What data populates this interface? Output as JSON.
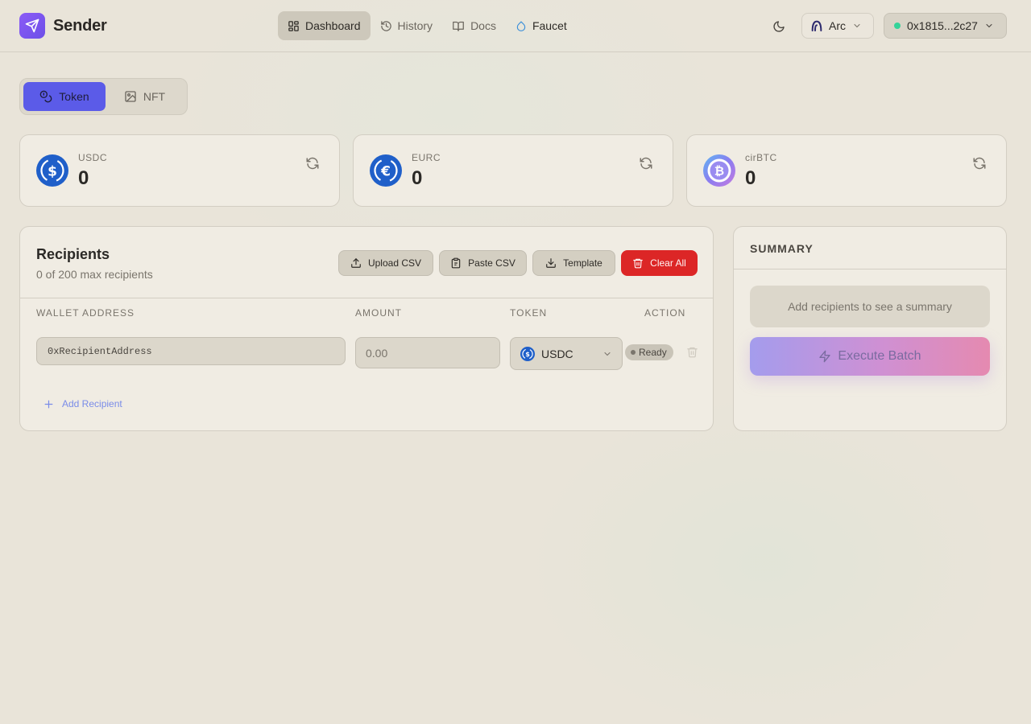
{
  "app": {
    "name": "Sender"
  },
  "nav": {
    "dashboard": "Dashboard",
    "history": "History",
    "docs": "Docs",
    "faucet": "Faucet"
  },
  "header": {
    "chain_label": "Arc",
    "wallet_address": "0x1815...2c27",
    "wallet_status_color": "#34d399"
  },
  "mode": {
    "token": "Token",
    "nft": "NFT",
    "active": "Token"
  },
  "balances": [
    {
      "symbol": "USDC",
      "amount": "0",
      "icon": "usdc-icon",
      "color": "#1f5fc9"
    },
    {
      "symbol": "EURC",
      "amount": "0",
      "icon": "eurc-icon",
      "color": "#1f5fc9"
    },
    {
      "symbol": "cirBTC",
      "amount": "0",
      "icon": "cirbtc-icon",
      "color": "#8b7cf0"
    }
  ],
  "recipients": {
    "title": "Recipients",
    "subtitle": "0 of 200 max recipients",
    "buttons": {
      "upload": "Upload CSV",
      "paste": "Paste CSV",
      "template": "Template",
      "clear": "Clear All"
    },
    "columns": {
      "address": "WALLET ADDRESS",
      "amount": "AMOUNT",
      "token": "TOKEN",
      "action": "ACTION"
    },
    "row": {
      "address_placeholder": "0xRecipientAddress",
      "amount_placeholder": "0.00",
      "token": "USDC",
      "status": "Ready"
    },
    "add_label": "Add Recipient"
  },
  "summary": {
    "title": "SUMMARY",
    "empty_text": "Add recipients to see a summary",
    "execute_label": "Execute Batch"
  },
  "colors": {
    "accent": "#5b5be8",
    "danger": "#dc2626",
    "logo": "#7c5cf0"
  }
}
